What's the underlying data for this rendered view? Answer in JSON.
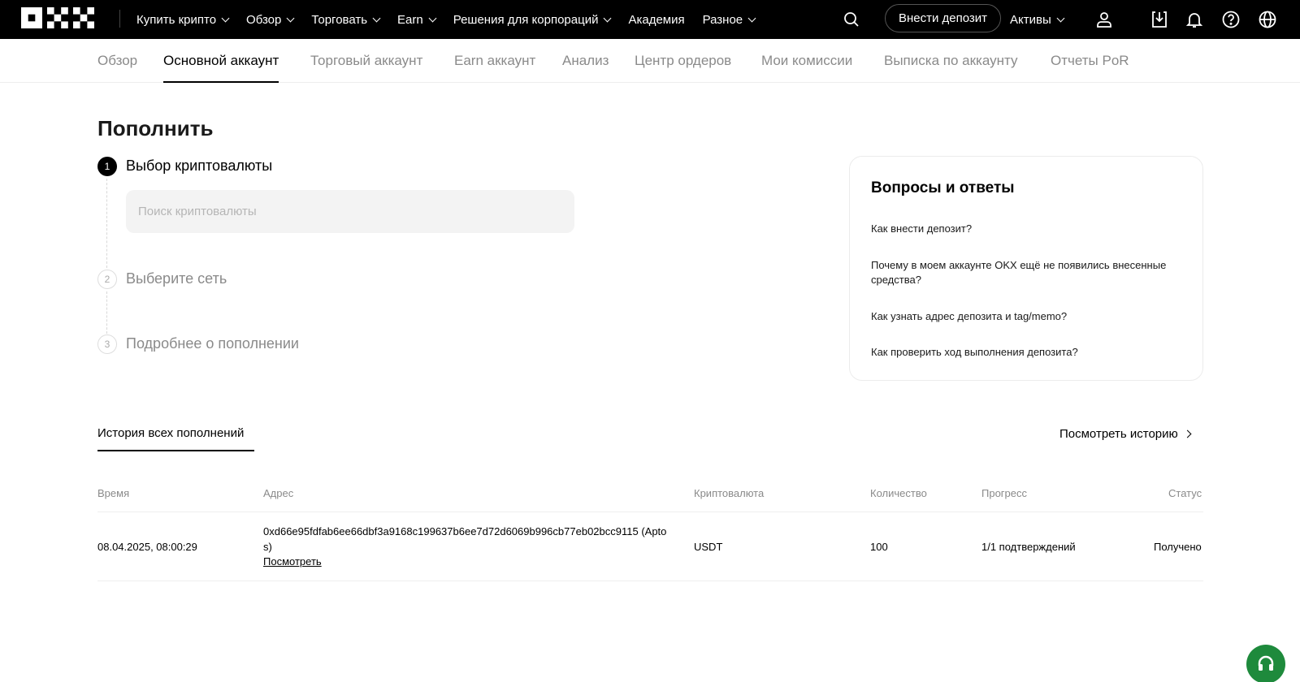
{
  "topnav": {
    "items": [
      {
        "label": "Купить крипто",
        "dropdown": true
      },
      {
        "label": "Обзор",
        "dropdown": true
      },
      {
        "label": "Торговать",
        "dropdown": true
      },
      {
        "label": "Earn",
        "dropdown": true
      },
      {
        "label": "Решения для корпораций",
        "dropdown": true
      },
      {
        "label": "Академия",
        "dropdown": false
      },
      {
        "label": "Разное",
        "dropdown": true
      }
    ],
    "deposit_button": "Внести депозит",
    "assets_label": "Активы"
  },
  "subtabs": [
    {
      "label": "Обзор",
      "active": false
    },
    {
      "label": "Основной аккаунт",
      "active": true
    },
    {
      "label": "Торговый аккаунт",
      "active": false
    },
    {
      "label": "Earn аккаунт",
      "active": false
    },
    {
      "label": "Анализ",
      "active": false
    },
    {
      "label": "Центр ордеров",
      "active": false
    },
    {
      "label": "Мои комиссии",
      "active": false
    },
    {
      "label": "Выписка по аккаунту",
      "active": false
    },
    {
      "label": "Отчеты PoR",
      "active": false
    }
  ],
  "page_title": "Пополнить",
  "steps": [
    {
      "num": "1",
      "label": "Выбор криптовалюты",
      "active": true
    },
    {
      "num": "2",
      "label": "Выберите сеть",
      "active": false
    },
    {
      "num": "3",
      "label": "Подробнее о пополнении",
      "active": false
    }
  ],
  "search": {
    "placeholder": "Поиск криптовалюты",
    "value": ""
  },
  "faq": {
    "title": "Вопросы и ответы",
    "items": [
      "Как внести депозит?",
      "Почему в моем аккаунте OKX ещё не появились внесенные средства?",
      "Как узнать адрес депозита и tag/memo?",
      "Как проверить ход выполнения депозита?"
    ]
  },
  "history": {
    "tab_label": "История всех пополнений",
    "view_history": "Посмотреть историю",
    "columns": [
      "Время",
      "Адрес",
      "Криптовалюта",
      "Количество",
      "Прогресс",
      "Статус"
    ],
    "rows": [
      {
        "time": "08.04.2025, 08:00:29",
        "address": "0xd66e95fdfab6ee66dbf3a9168c199637b6ee7d72d6069b996cb77eb02bcc9115 (Aptos)",
        "view_label": "Посмотреть",
        "currency": "USDT",
        "amount": "100",
        "progress": "1/1 подтверждений",
        "status": "Получено"
      }
    ]
  },
  "colors": {
    "topbar": "#000000",
    "support": "#1e8a3c",
    "muted": "#8a8a8a"
  }
}
